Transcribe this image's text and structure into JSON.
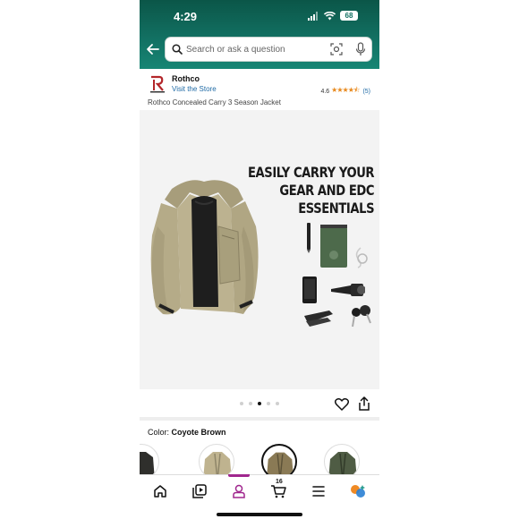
{
  "status_bar": {
    "time": "4:29",
    "battery": "68"
  },
  "search": {
    "placeholder": "Search or ask a question"
  },
  "seller": {
    "brand": "Rothco",
    "visit_store": "Visit the Store",
    "rating": "4.6",
    "rating_count": "(5)",
    "product_title": "Rothco Concealed Carry 3 Season Jacket"
  },
  "gallery": {
    "headline_lines": [
      "EASILY CARRY YOUR",
      "GEAR AND EDC",
      "ESSENTIALS"
    ],
    "notepad_text": "RITE IN THE RAIN",
    "dot_count": 5,
    "active_dot": 2
  },
  "color": {
    "label": "Color:",
    "value": "Coyote Brown"
  },
  "swatches": [
    {
      "color": "#2f2f2c"
    },
    {
      "color": "#bfb38f"
    },
    {
      "color": "#8a7a55"
    },
    {
      "color": "#4f5c44"
    }
  ],
  "bottom_nav": {
    "cart_count": "16"
  },
  "colors": {
    "header": "#127062",
    "link": "#1f6aa5",
    "star": "#e8891d",
    "active_nav": "#a0278e"
  }
}
